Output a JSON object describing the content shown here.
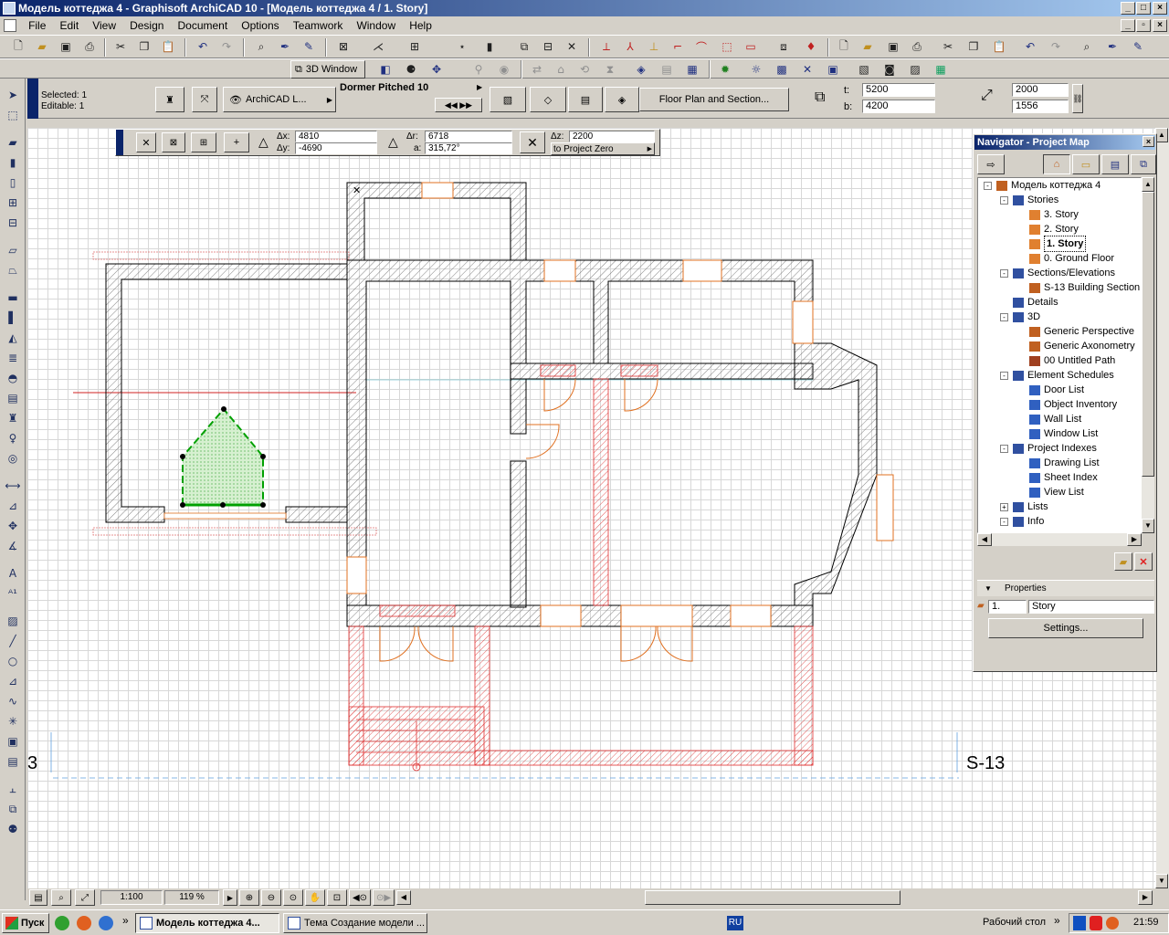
{
  "window": {
    "title": "Модель коттеджа 4 - Graphisoft ArchiCAD 10 - [Модель коттеджа 4 / 1. Story]"
  },
  "menubar": {
    "items": [
      "File",
      "Edit",
      "View",
      "Design",
      "Document",
      "Options",
      "Teamwork",
      "Window",
      "Help"
    ]
  },
  "toolbar2": {
    "window_3d_label": "3D Window"
  },
  "infobox": {
    "selected": "Selected: 1",
    "editable": "Editable: 1",
    "layer_label": "ArchiCAD L...",
    "roof_type": "Dormer Pitched 10",
    "view_button": "Floor Plan and Section...",
    "t_label": "t:",
    "t_value": "5200",
    "b_label": "b:",
    "b_value": "4200",
    "width_value": "2000",
    "height_value": "1556"
  },
  "coordinates": {
    "dx_label": "Δx:",
    "dx_value": "4810",
    "dy_label": "Δy:",
    "dy_value": "-4690",
    "dr_label": "Δr:",
    "dr_value": "6718",
    "a_label": "a:",
    "a_value": "315,72°",
    "dz_label": "Δz:",
    "dz_value": "2200",
    "ref_label": "to Project Zero"
  },
  "canvas": {
    "section_left_label": "3",
    "section_right_label": "S-13"
  },
  "navigator": {
    "title": "Navigator - Project Map",
    "tree": [
      {
        "label": "Модель коттеджа 4",
        "level": 0,
        "toggle": "-",
        "icon": "project"
      },
      {
        "label": "Stories",
        "level": 1,
        "toggle": "-",
        "icon": "folder"
      },
      {
        "label": "3. Story",
        "level": 2,
        "icon": "story"
      },
      {
        "label": "2. Story",
        "level": 2,
        "icon": "story"
      },
      {
        "label": "1. Story",
        "level": 2,
        "icon": "story",
        "selected": true
      },
      {
        "label": "0. Ground Floor",
        "level": 2,
        "icon": "story"
      },
      {
        "label": "Sections/Elevations",
        "level": 1,
        "toggle": "-",
        "icon": "folder"
      },
      {
        "label": "S-13 Building Section",
        "level": 2,
        "icon": "section"
      },
      {
        "label": "Details",
        "level": 1,
        "icon": "folder"
      },
      {
        "label": "3D",
        "level": 1,
        "toggle": "-",
        "icon": "folder"
      },
      {
        "label": "Generic Perspective",
        "level": 2,
        "icon": "camera"
      },
      {
        "label": "Generic Axonometry",
        "level": 2,
        "icon": "cube"
      },
      {
        "label": "00 Untitled Path",
        "level": 2,
        "icon": "path"
      },
      {
        "label": "Element Schedules",
        "level": 1,
        "toggle": "-",
        "icon": "folder"
      },
      {
        "label": "Door List",
        "level": 2,
        "icon": "schedule"
      },
      {
        "label": "Object Inventory",
        "level": 2,
        "icon": "schedule"
      },
      {
        "label": "Wall List",
        "level": 2,
        "icon": "schedule"
      },
      {
        "label": "Window List",
        "level": 2,
        "icon": "schedule"
      },
      {
        "label": "Project Indexes",
        "level": 1,
        "toggle": "-",
        "icon": "folder"
      },
      {
        "label": "Drawing List",
        "level": 2,
        "icon": "index"
      },
      {
        "label": "Sheet Index",
        "level": 2,
        "icon": "index"
      },
      {
        "label": "View List",
        "level": 2,
        "icon": "index"
      },
      {
        "label": "Lists",
        "level": 1,
        "toggle": "+",
        "icon": "folder"
      },
      {
        "label": "Info",
        "level": 1,
        "toggle": "-",
        "icon": "folder"
      }
    ],
    "properties_label": "Properties",
    "prop_index": "1.",
    "prop_name": "Story",
    "settings_button": "Settings..."
  },
  "statusbar": {
    "scale": "1:100",
    "zoom": "119 %"
  },
  "taskbar": {
    "start_label": "Пуск",
    "tasks": [
      "Модель коттеджа 4...",
      "Тема Создание модели ..."
    ],
    "lang": "RU",
    "desktop_label": "Рабочий стол",
    "time": "21:59"
  },
  "colors": {
    "title_start": "#0a246a",
    "title_end": "#a6caf0",
    "wall": "#000000",
    "ground_floor": "#e03030",
    "door": "#e07020",
    "selection": "#00a000"
  }
}
